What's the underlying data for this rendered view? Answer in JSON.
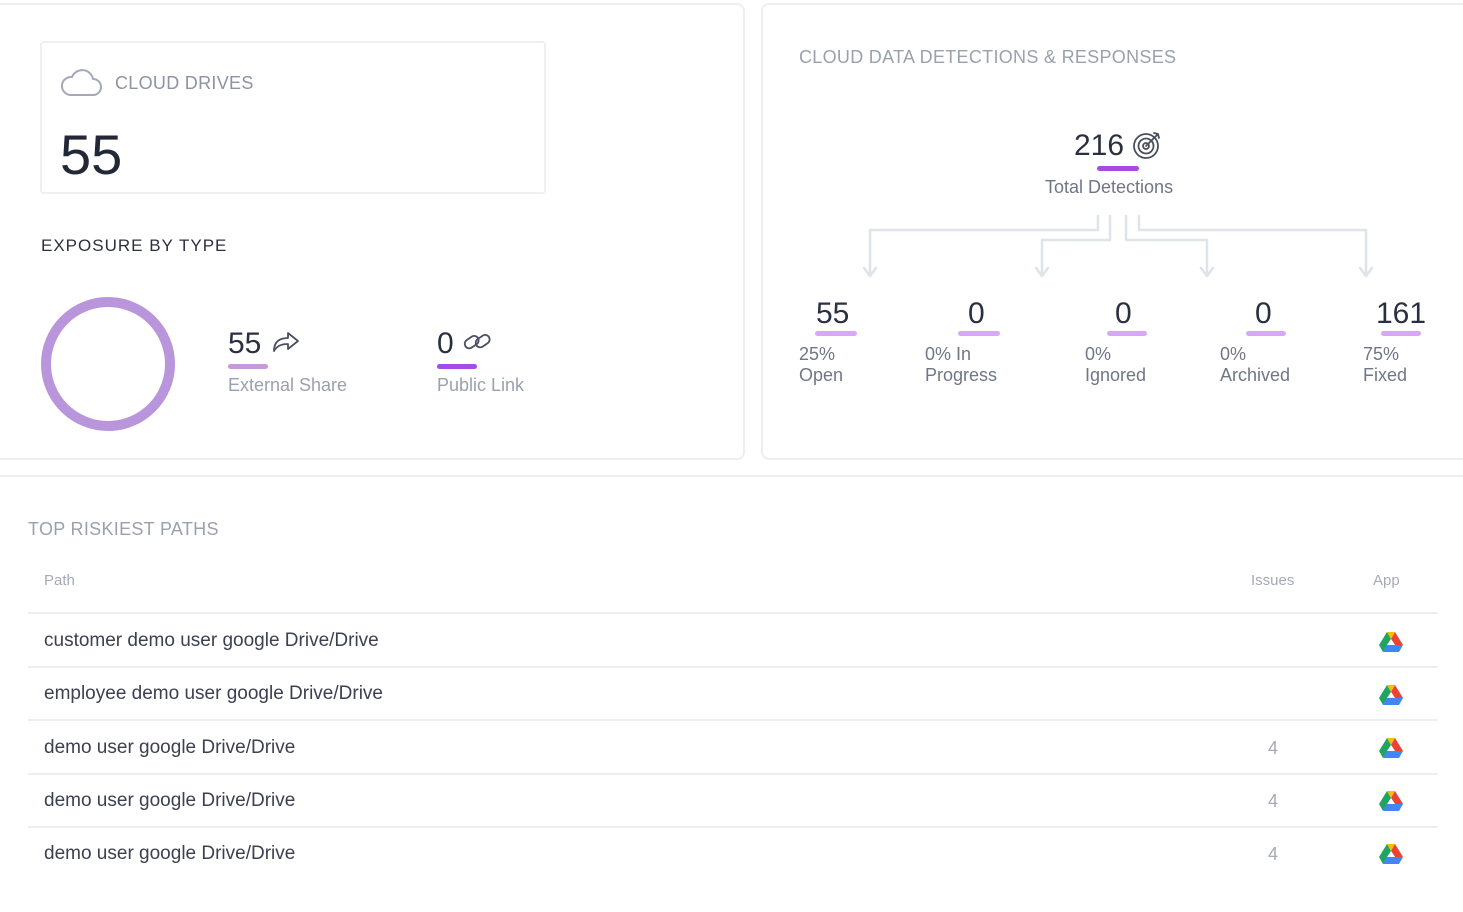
{
  "cloud_drives": {
    "title": "CLOUD DRIVES",
    "count": "55",
    "icon": "cloud-icon"
  },
  "exposure": {
    "title": "EXPOSURE BY TYPE",
    "donut_color": "#b995dc",
    "external_share": {
      "value": "55",
      "label": "External Share",
      "icon": "share-arrow-icon",
      "underline_color": "#c79ad9"
    },
    "public_link": {
      "value": "0",
      "label": "Public Link",
      "icon": "link-icon",
      "underline_color": "#a44be8"
    }
  },
  "detections": {
    "title": "CLOUD DATA DETECTIONS & RESPONSES",
    "total": "216",
    "total_label": "Total Detections",
    "total_icon": "target-icon",
    "accent": "#a44be8",
    "items": [
      {
        "value": "55",
        "pct": "25%",
        "label": "Open"
      },
      {
        "value": "0",
        "pct": "0% In",
        "label": "Progress"
      },
      {
        "value": "0",
        "pct": "0%",
        "label": "Ignored"
      },
      {
        "value": "0",
        "pct": "0%",
        "label": "Archived"
      },
      {
        "value": "161",
        "pct": "75%",
        "label": "Fixed"
      }
    ]
  },
  "riskiest": {
    "title": "TOP RISKIEST PATHS",
    "columns": {
      "path": "Path",
      "issues": "Issues",
      "app": "App"
    },
    "rows": [
      {
        "path": "customer demo user google Drive/Drive",
        "issues": "",
        "app": "google-drive-icon"
      },
      {
        "path": "employee demo user google Drive/Drive",
        "issues": "",
        "app": "google-drive-icon"
      },
      {
        "path": "demo user google Drive/Drive",
        "issues": "4",
        "app": "google-drive-icon"
      },
      {
        "path": "demo user google Drive/Drive",
        "issues": "4",
        "app": "google-drive-icon"
      },
      {
        "path": "demo user google Drive/Drive",
        "issues": "4",
        "app": "google-drive-icon"
      }
    ]
  }
}
